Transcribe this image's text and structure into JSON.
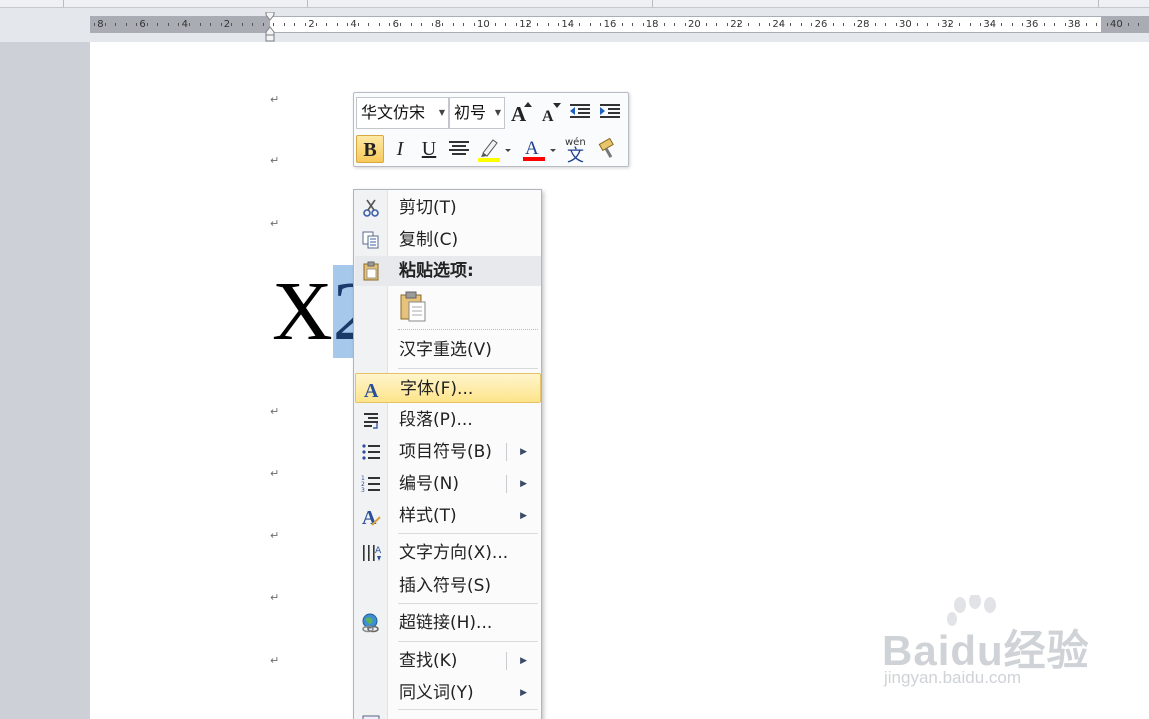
{
  "ruler": {
    "numbers": [
      "8",
      "6",
      "4",
      "2",
      "2",
      "4",
      "6",
      "8",
      "10",
      "12",
      "14",
      "16",
      "18",
      "20",
      "22",
      "24",
      "26",
      "28",
      "30",
      "32",
      "34",
      "36",
      "38",
      "40"
    ]
  },
  "document": {
    "paragraph_mark": "↵",
    "text_unselected": "X",
    "text_selected": "2"
  },
  "mini_toolbar": {
    "font_name": "华文仿宋",
    "font_size": "初号",
    "bold": "B",
    "italic": "I",
    "underline": "U",
    "grow_font": "A",
    "shrink_font": "A",
    "font_color_letter": "A",
    "phonetic_top": "wén",
    "phonetic_char": "文",
    "highlight_color": "#ffff00",
    "font_color": "#ff0000"
  },
  "context_menu": {
    "cut": "剪切(T)",
    "copy": "复制(C)",
    "paste_options": "粘贴选项:",
    "reconvert": "汉字重选(V)",
    "font": "字体(F)...",
    "paragraph": "段落(P)...",
    "bullets": "项目符号(B)",
    "numbering": "编号(N)",
    "styles": "样式(T)",
    "text_direction": "文字方向(X)...",
    "insert_symbol": "插入符号(S)",
    "hyperlink": "超链接(H)...",
    "find": "查找(K)",
    "synonyms": "同义词(Y)"
  },
  "watermark": {
    "brand": "Baidu经验",
    "url": "jingyan.baidu.com"
  }
}
